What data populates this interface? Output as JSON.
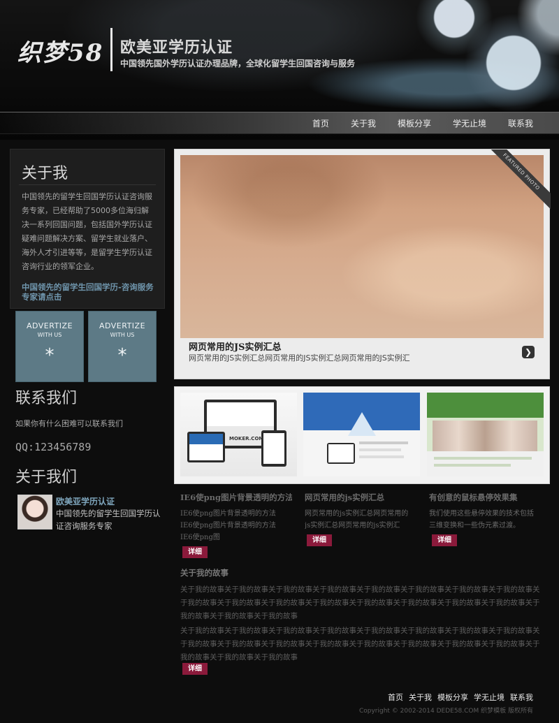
{
  "header": {
    "logo": "织梦58",
    "title": "欧美亚学历认证",
    "subtitle": "中国领先国外学历认证办理品牌，全球化留学生回国咨询与服务"
  },
  "nav": [
    "首页",
    "关于我",
    "模板分享",
    "学无止境",
    "联系我"
  ],
  "sidebar": {
    "about_title": "关于我",
    "about_text": "中国领先的留学生回国学历认证咨询服务专家，已经帮助了5000多位海归解决一系列回国问题，包括国外学历认证疑难问题解决方案、留学生就业落户、海外人才引进等等，是留学生学历认证咨询行业的领军企业。",
    "about_cta": "中国领先的留学生回国学历-咨询服务专家请点击",
    "ads": [
      {
        "line1": "ADVERTIZE",
        "line2": "WITH US",
        "icon": "*"
      },
      {
        "line1": "ADVERTIZE",
        "line2": "WITH US",
        "icon": "*"
      }
    ],
    "contact_title": "联系我们",
    "contact_text": "如果你有什么困难可以联系我们",
    "qq": "QQ:123456789",
    "aboutus_title": "关于我们",
    "aboutus_name": "欧美亚学历认证",
    "aboutus_desc": "中国领先的留学生回国学历认证咨询服务专家"
  },
  "featured": {
    "ribbon": "FEATURED PHOTO",
    "title": "网页常用的JS实例汇总",
    "desc": "网页常用的JS实例汇总网页常用的JS实例汇总网页常用的JS实例汇",
    "next_icon": "chevron-right-icon"
  },
  "thumbs": {
    "moker_label": "MOKER.COM"
  },
  "articles": [
    {
      "title": "IE6使png图片背景透明的方法",
      "desc": "IE6使png图片背景透明的方法IE6使png图片背景透明的方法IE6使png图",
      "button": "详细"
    },
    {
      "title": "网页常用的js实例汇总",
      "desc": "网页常用的js实例汇总网页常用的js实例汇总网页常用的js实例汇",
      "button": "详细"
    },
    {
      "title": "有创意的鼠标悬停效果集",
      "desc": "我们使用这些悬停效果的技术包括三维变换和一些伪元素过渡。",
      "button": "详细"
    }
  ],
  "story": {
    "title": "关于我的故事",
    "p1": "关于我的故事关于我的故事关于我的故事关于我的故事关于我的故事关于我的故事关于我的故事关于我的故事关于我的故事关于我的故事关于我的故事关于我的故事关于我的故事关于我的故事关于我的故事关于我的故事关于我的故事关于我的故事关于我的故事",
    "p2": "关于我的故事关于我的故事关于我的故事关于我的故事关于我的故事关于我的故事关于我的故事关于我的故事关于我的故事关于我的故事关于我的故事关于我的故事关于我的故事关于我的故事关于我的故事关于我的故事关于我的故事关于我的故事关于我的故事",
    "button": "详细"
  },
  "footer": {
    "nav": [
      "首页",
      "关于我",
      "模板分享",
      "学无止境",
      "联系我"
    ],
    "copyright": "Copyright © 2002-2014 DEDE58.COM 织梦模板 版权所有"
  },
  "colors": {
    "accent_link": "#6f95ac",
    "detail_button": "#8b1a3b",
    "ad_box": "#5d7a86"
  }
}
